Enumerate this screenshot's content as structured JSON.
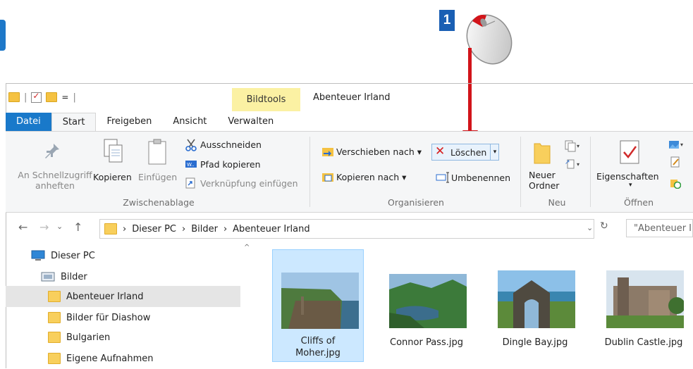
{
  "step_badge": "1",
  "quick_access": {
    "separator": "|",
    "dropdown": "="
  },
  "window_title": "Abenteuer Irland",
  "context_tab_group": "Bildtools",
  "tabs": [
    {
      "label": "Datei"
    },
    {
      "label": "Start"
    },
    {
      "label": "Freigeben"
    },
    {
      "label": "Ansicht"
    },
    {
      "label": "Verwalten"
    }
  ],
  "ribbon": {
    "clipboard": {
      "pin_label_1": "An Schnellzugriff",
      "pin_label_2": "anheften",
      "copy": "Kopieren",
      "paste": "Einfügen",
      "cut": "Ausschneiden",
      "copy_path": "Pfad kopieren",
      "paste_shortcut": "Verknüpfung einfügen",
      "group_label": "Zwischenablage"
    },
    "organize": {
      "move_to": "Verschieben nach",
      "copy_to": "Kopieren nach",
      "delete": "Löschen",
      "rename": "Umbenennen",
      "group_label": "Organisieren"
    },
    "new": {
      "new_folder_1": "Neuer",
      "new_folder_2": "Ordner",
      "group_label": "Neu"
    },
    "open": {
      "properties": "Eigenschaften",
      "group_label": "Öffnen"
    }
  },
  "address": {
    "crumbs": [
      "Dieser PC",
      "Bilder",
      "Abenteuer Irland"
    ],
    "separator": "›",
    "search_placeholder": "\"Abenteuer Ir"
  },
  "tree": {
    "items": [
      {
        "label": "Dieser PC"
      },
      {
        "label": "Bilder"
      },
      {
        "label": "Abenteuer Irland"
      },
      {
        "label": "Bilder für Diashow"
      },
      {
        "label": "Bulgarien"
      },
      {
        "label": "Eigene Aufnahmen"
      }
    ]
  },
  "files": [
    {
      "name_1": "Cliffs of",
      "name_2": "Moher.jpg"
    },
    {
      "name_1": "Connor Pass.jpg"
    },
    {
      "name_1": "Dingle Bay.jpg"
    },
    {
      "name_1": "Dublin Castle.jpg"
    }
  ],
  "colors": {
    "accent": "#1979ca",
    "arrow": "#d2141a",
    "delete_x": "#d71d1d",
    "selection": "#cce8ff"
  }
}
